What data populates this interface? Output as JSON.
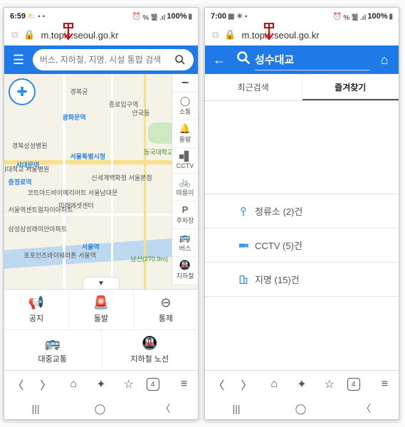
{
  "left": {
    "status": {
      "time": "6:59",
      "icons_left": "⛅ ▪ ▪",
      "alarm": "⏰",
      "net": "% 뛟 .ıl",
      "battery": "100%",
      "batt_icon": "▮"
    },
    "url": "m.topis.seoul.go.kr",
    "search_placeholder": "버스, 지하철, 지명, 시설 통합 검색",
    "layers": {
      "minus": "−",
      "items": [
        {
          "icon": "◯",
          "label": "소통"
        },
        {
          "icon": "🔔",
          "label": "돌발"
        },
        {
          "icon": "■▋",
          "label": "CCTV"
        },
        {
          "icon": "🚲",
          "label": "따릉이"
        },
        {
          "icon": "P",
          "label": "주차장"
        },
        {
          "icon": "🚌",
          "label": "버스"
        },
        {
          "icon": "🚇",
          "label": "지하철"
        }
      ]
    },
    "map_labels": {
      "a": "서울특별시청",
      "b": "광화문역",
      "c": "종로입구역",
      "d": "안국동",
      "e": "경복궁",
      "f": "경복상성병원",
      "g": "서대문역",
      "h": "신세계백화점 서울본점",
      "i": "동국대학교",
      "j": "삼성삼성래미안아파트",
      "k": "포포인츠바이쉐라톤 서울역",
      "l": "남산(270.9m)",
      "m": "서울역",
      "n": "서울역센트럴자이아파트",
      "o": "미래에셋센터",
      "p": "코트야드바이메리어트 서울남대문",
      "q": "충정로역",
      "r": "기대학교 서울병원"
    },
    "quick": {
      "notice": {
        "label": "공지"
      },
      "event": {
        "label": "돌발"
      },
      "control": {
        "label": "통제"
      },
      "transit": {
        "label": "대중교통"
      },
      "subway": {
        "label": "지하철 노선"
      }
    }
  },
  "right": {
    "status": {
      "time": "7:00",
      "icons_left": "▦ ☀ ▪",
      "alarm": "⏰",
      "net": "% 뛟 .ıl",
      "battery": "100%",
      "batt_icon": "▮"
    },
    "url": "m.topis.seoul.go.kr",
    "search_term": "성수대교",
    "tabs": {
      "recent": "최근검색",
      "fav": "즐겨찾기"
    },
    "results": {
      "stops": "정류소 (2)건",
      "cctv": "CCTV (5)건",
      "places": "지명 (15)건"
    }
  },
  "browser_nav": {
    "tab_count": "4"
  }
}
